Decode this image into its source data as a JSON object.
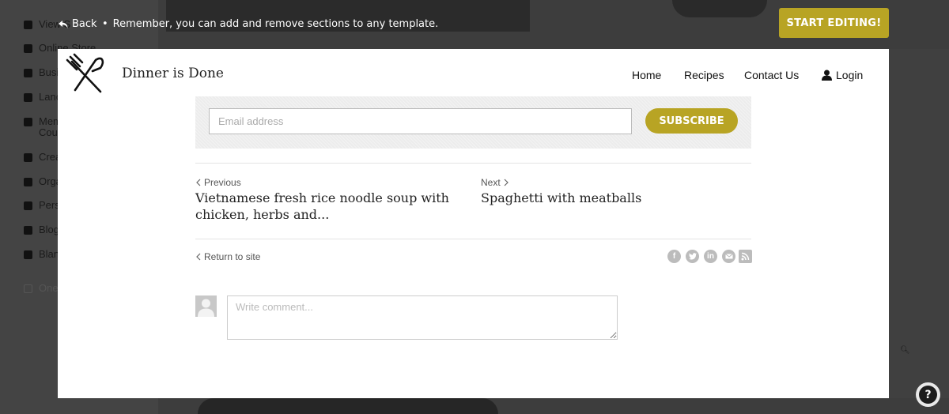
{
  "background_sidebar": {
    "items": [
      {
        "label": "View S",
        "icon": "star-icon"
      },
      {
        "label": "Online Store",
        "icon": "cart-icon"
      },
      {
        "label": "Busi",
        "icon": "doc-icon"
      },
      {
        "label": "Lanc",
        "icon": "window-icon"
      },
      {
        "label": "Mem",
        "label2": "Cou",
        "icon": "card-icon"
      },
      {
        "label": "Crea",
        "icon": "palette-icon"
      },
      {
        "label": "Orga",
        "icon": "calendar-icon"
      },
      {
        "label": "Pers",
        "icon": "user-icon"
      },
      {
        "label": "Blog",
        "icon": "pen-icon"
      },
      {
        "label": "Blan",
        "icon": "plus-circle-icon"
      },
      {
        "label": "One",
        "icon": "page-icon"
      }
    ]
  },
  "topbar": {
    "back_label": "Back",
    "separator": "•",
    "hint": "Remember, you can add and remove sections to any template.",
    "start_editing_label": "START EDITING!"
  },
  "site": {
    "title": "Dinner is Done",
    "nav": {
      "home": "Home",
      "recipes": "Recipes",
      "contact": "Contact Us",
      "login": "Login"
    }
  },
  "subscribe": {
    "email_placeholder": "Email address",
    "button_label": "SUBSCRIBE"
  },
  "post_nav": {
    "previous_label": "Previous",
    "previous_title": "Vietnamese fresh rice noodle soup with chicken, herbs and...",
    "next_label": "Next",
    "next_title": "Spaghetti with meatballs"
  },
  "return_label": "Return to site",
  "social_icons": [
    "facebook-icon",
    "twitter-icon",
    "linkedin-icon",
    "email-icon",
    "rss-icon"
  ],
  "comment": {
    "placeholder": "Write comment..."
  },
  "help": {
    "label": "?"
  },
  "colors": {
    "accent": "#b8a424",
    "overlay": "#3d3d3d"
  }
}
